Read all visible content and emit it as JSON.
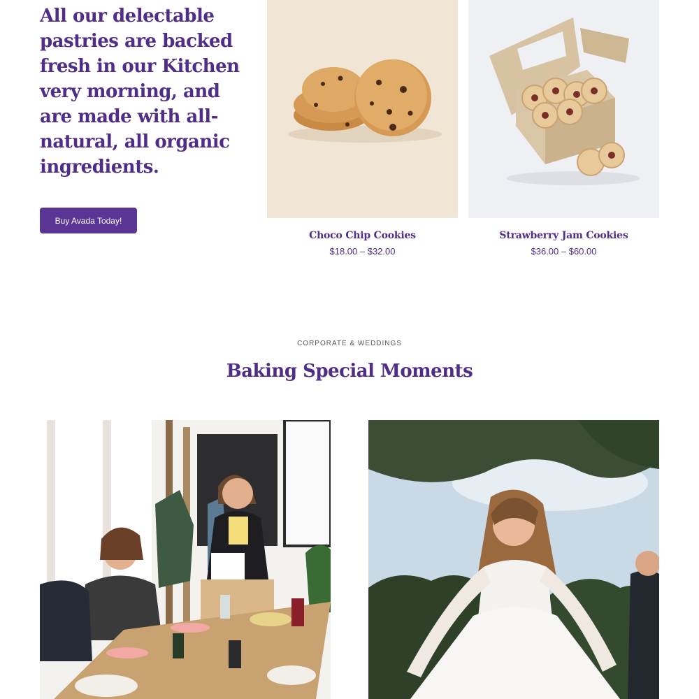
{
  "hero": {
    "headline": "All our delectable pastries are backed fresh in our Kitchen very morning, and are made with all-natural, all organic ingredients.",
    "cta_label": "Buy Avada Today!"
  },
  "products": [
    {
      "name": "Choco Chip Cookies",
      "price": "$18.00 – $32.00",
      "image": "choco-chip-cookies-image"
    },
    {
      "name": "Strawberry Jam Cookies",
      "price": "$36.00 – $60.00",
      "image": "jam-cookies-box-image"
    }
  ],
  "section": {
    "eyebrow": "CORPORATE & WEDDINGS",
    "title": "Baking Special Moments"
  },
  "photos": [
    {
      "image": "corporate-meeting-photo"
    },
    {
      "image": "wedding-bride-photo"
    }
  ],
  "colors": {
    "accent": "#4f2d88",
    "button": "#5a3594",
    "card_cookie_bg": "#f1e6d6",
    "card_box_bg": "#eef0f4"
  }
}
